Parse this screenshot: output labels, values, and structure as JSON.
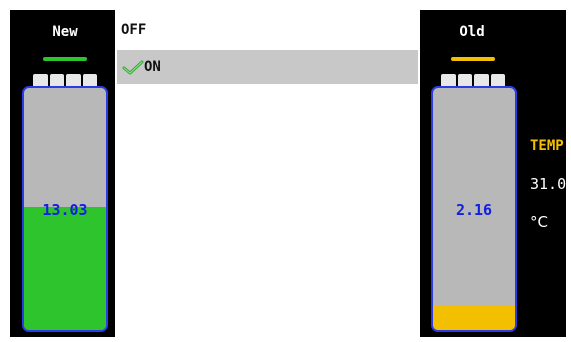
{
  "battery_new": {
    "title": "New",
    "value": "13.03",
    "level": 0.51,
    "fill_color": "#2ec42e",
    "indicator_color": "#2ec42e"
  },
  "battery_old": {
    "title": "Old",
    "value": "2.16",
    "level": 0.1,
    "fill_color": "#f2c000",
    "indicator_color": "#f2c000"
  },
  "menu": {
    "items": [
      {
        "label": "OFF",
        "selected": false
      },
      {
        "label": "ON",
        "selected": true,
        "icon": "checkmark-icon"
      }
    ]
  },
  "temperature": {
    "label": "TEMP",
    "value": "31.0",
    "unit": "°C"
  }
}
